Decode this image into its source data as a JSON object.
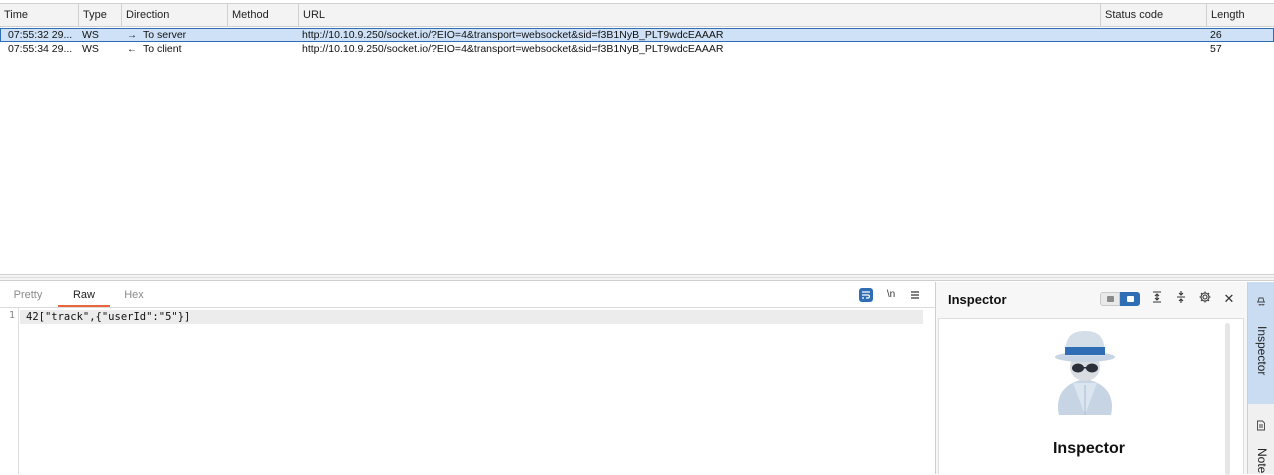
{
  "history": {
    "columns": [
      "Time",
      "Type",
      "Direction",
      "Method",
      "URL",
      "Status code",
      "Length"
    ],
    "rows": [
      {
        "time": "07:55:32 29...",
        "type": "WS",
        "arrow": "→",
        "direction": "To server",
        "method": "",
        "url": "http://10.10.9.250/socket.io/?EIO=4&transport=websocket&sid=f3B1NyB_PLT9wdcEAAAR",
        "status": "",
        "length": "26",
        "selected": true
      },
      {
        "time": "07:55:34 29...",
        "type": "WS",
        "arrow": "←",
        "direction": "To client",
        "method": "",
        "url": "http://10.10.9.250/socket.io/?EIO=4&transport=websocket&sid=f3B1NyB_PLT9wdcEAAAR",
        "status": "",
        "length": "57",
        "selected": false
      }
    ]
  },
  "editor": {
    "tabs": [
      "Pretty",
      "Raw",
      "Hex"
    ],
    "active_tab": "Raw",
    "newline_label": "\\n",
    "line_number": "1",
    "content": "42[\"track\",{\"userId\":\"5\"}]"
  },
  "inspector": {
    "title": "Inspector",
    "heading": "Inspector",
    "close_glyph": "✕"
  },
  "side_tabs": {
    "inspector_label": "Inspector",
    "notes_label": "Notes"
  },
  "colors": {
    "accent": "#2f6db5",
    "active_tab_underline": "#e8673c",
    "selected_row": "#cfe1f6"
  }
}
